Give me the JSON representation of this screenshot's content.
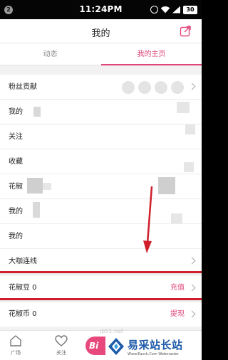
{
  "status_bar": {
    "badge": "2",
    "time": "11:24PM",
    "battery": "30",
    "icons": [
      "alarm-icon",
      "wifi-icon",
      "signal-icon",
      "battery-icon"
    ]
  },
  "header": {
    "title": "我的",
    "share_icon": "share-icon"
  },
  "tabs": [
    {
      "label": "动态",
      "active": false
    },
    {
      "label": "我的主页",
      "active": true
    }
  ],
  "list": {
    "rows": [
      {
        "label": "粉丝贡献",
        "chevron": true
      },
      {
        "label": "我的",
        "chevron": false
      },
      {
        "label": "关注",
        "chevron": false
      },
      {
        "label": "收藏",
        "chevron": false
      },
      {
        "label": "花椒",
        "chevron": false
      },
      {
        "label": "我的",
        "chevron": false
      },
      {
        "label": "我的",
        "chevron": false
      },
      {
        "label": "大咖连线",
        "chevron": true
      }
    ]
  },
  "wallet": {
    "beans": {
      "label": "花椒豆 0",
      "action": "充值"
    },
    "coins": {
      "label": "花椒币 0",
      "action": "提现"
    }
  },
  "bottom_nav": {
    "items": [
      {
        "label": "广场",
        "icon": "home-icon"
      },
      {
        "label": "关注",
        "icon": "heart-icon"
      }
    ],
    "fab_label": "Bi"
  },
  "watermark": {
    "site": "易采站长站",
    "sub": "Www.Easck.Com Webmaster",
    "url": "jb51.net"
  },
  "colors": {
    "accent": "#e0457b",
    "annotation_red": "#cf1f2b",
    "watermark_blue": "#1e5aa8"
  }
}
